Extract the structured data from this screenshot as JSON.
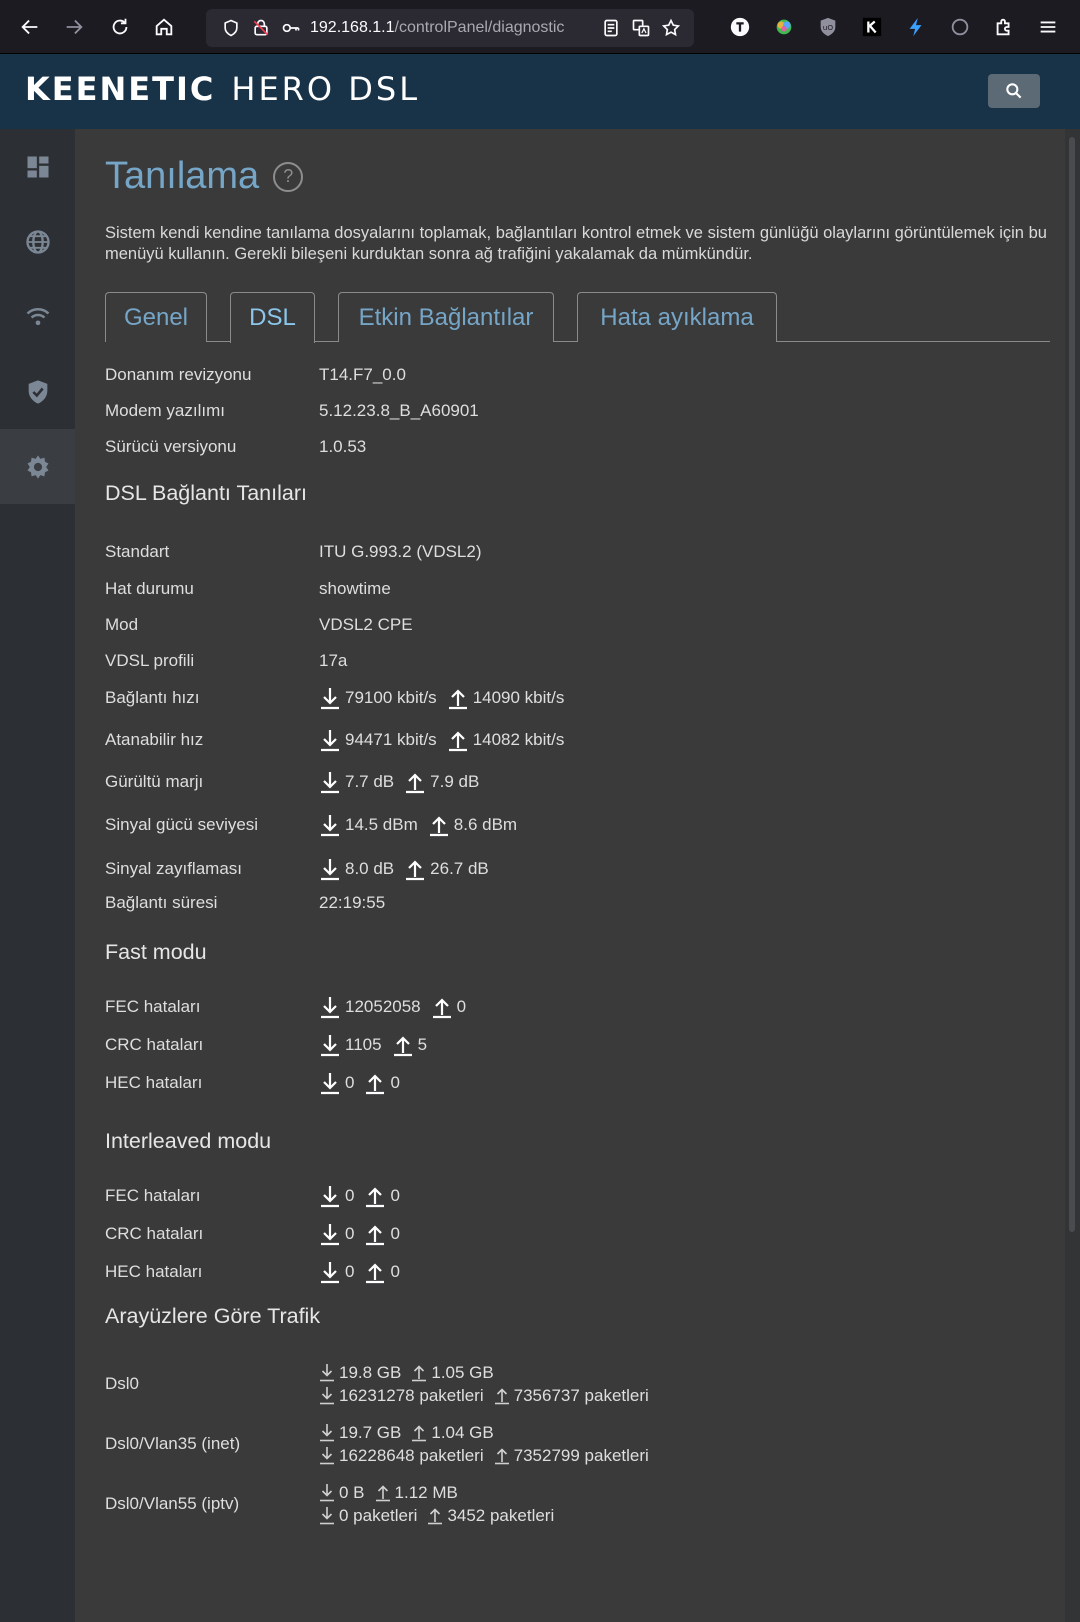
{
  "browser": {
    "url_host": "192.168.1.1",
    "url_path": "/controlPanel/diagnostic"
  },
  "header": {
    "brand": "KEENETIC",
    "model": "HERO DSL"
  },
  "page": {
    "title": "Tanılama",
    "help": "?",
    "description": "Sistem kendi kendine tanılama dosyalarını toplamak, bağlantıları kontrol etmek ve sistem günlüğü olaylarını görüntülemek için bu menüyü kullanın. Gerekli bileşeni kurduktan sonra ağ trafiğini yakalamak da mümkündür."
  },
  "tabs": [
    {
      "label": "Genel",
      "active": false
    },
    {
      "label": "DSL",
      "active": true
    },
    {
      "label": "Etkin Bağlantılar",
      "active": false
    },
    {
      "label": "Hata ayıklama",
      "active": false
    }
  ],
  "info": [
    {
      "label": "Donanım revizyonu",
      "value": "T14.F7_0.0"
    },
    {
      "label": "Modem yazılımı",
      "value": "5.12.23.8_B_A60901"
    },
    {
      "label": "Sürücü versiyonu",
      "value": "1.0.53"
    }
  ],
  "dsl_section": {
    "title": "DSL Bağlantı Tanıları",
    "standart": {
      "label": "Standart",
      "value": "ITU G.993.2 (VDSL2)"
    },
    "hat": {
      "label": "Hat durumu",
      "value": "showtime"
    },
    "mod": {
      "label": "Mod",
      "value": "VDSL2 CPE"
    },
    "profil": {
      "label": "VDSL profili",
      "value": "17a"
    },
    "baglanti_hizi": {
      "label": "Bağlantı hızı",
      "down": "79100 kbit/s",
      "up": "14090 kbit/s"
    },
    "atanabilir_hiz": {
      "label": "Atanabilir hız",
      "down": "94471 kbit/s",
      "up": "14082 kbit/s"
    },
    "gurultu": {
      "label": "Gürültü marjı",
      "down": "7.7 dB",
      "up": "7.9 dB"
    },
    "sinyal_gucu": {
      "label": "Sinyal gücü seviyesi",
      "down": "14.5 dBm",
      "up": "8.6 dBm"
    },
    "zayiflama": {
      "label": "Sinyal zayıflaması",
      "down": "8.0 dB",
      "up": "26.7 dB"
    },
    "sure": {
      "label": "Bağlantı süresi",
      "value": "22:19:55"
    }
  },
  "fast": {
    "title": "Fast modu",
    "fec": {
      "label": "FEC hataları",
      "down": "12052058",
      "up": "0"
    },
    "crc": {
      "label": "CRC hataları",
      "down": "1105",
      "up": "5"
    },
    "hec": {
      "label": "HEC hataları",
      "down": "0",
      "up": "0"
    }
  },
  "interleaved": {
    "title": "Interleaved modu",
    "fec": {
      "label": "FEC hataları",
      "down": "0",
      "up": "0"
    },
    "crc": {
      "label": "CRC hataları",
      "down": "0",
      "up": "0"
    },
    "hec": {
      "label": "HEC hataları",
      "down": "0",
      "up": "0"
    }
  },
  "traffic": {
    "title": "Arayüzlere Göre Trafik",
    "dsl0": {
      "label": "Dsl0",
      "down_bytes": "19.8 GB",
      "up_bytes": "1.05 GB",
      "down_pkts": "16231278 paketleri",
      "up_pkts": "7356737 paketleri"
    },
    "vlan35": {
      "label": "Dsl0/Vlan35 (inet)",
      "down_bytes": "19.7 GB",
      "up_bytes": "1.04 GB",
      "down_pkts": "16228648 paketleri",
      "up_pkts": "7352799 paketleri"
    },
    "vlan55": {
      "label": "Dsl0/Vlan55 (iptv)",
      "down_bytes": "0 B",
      "up_bytes": "1.12 MB",
      "down_pkts": "0 paketleri",
      "up_pkts": "3452 paketleri"
    }
  }
}
